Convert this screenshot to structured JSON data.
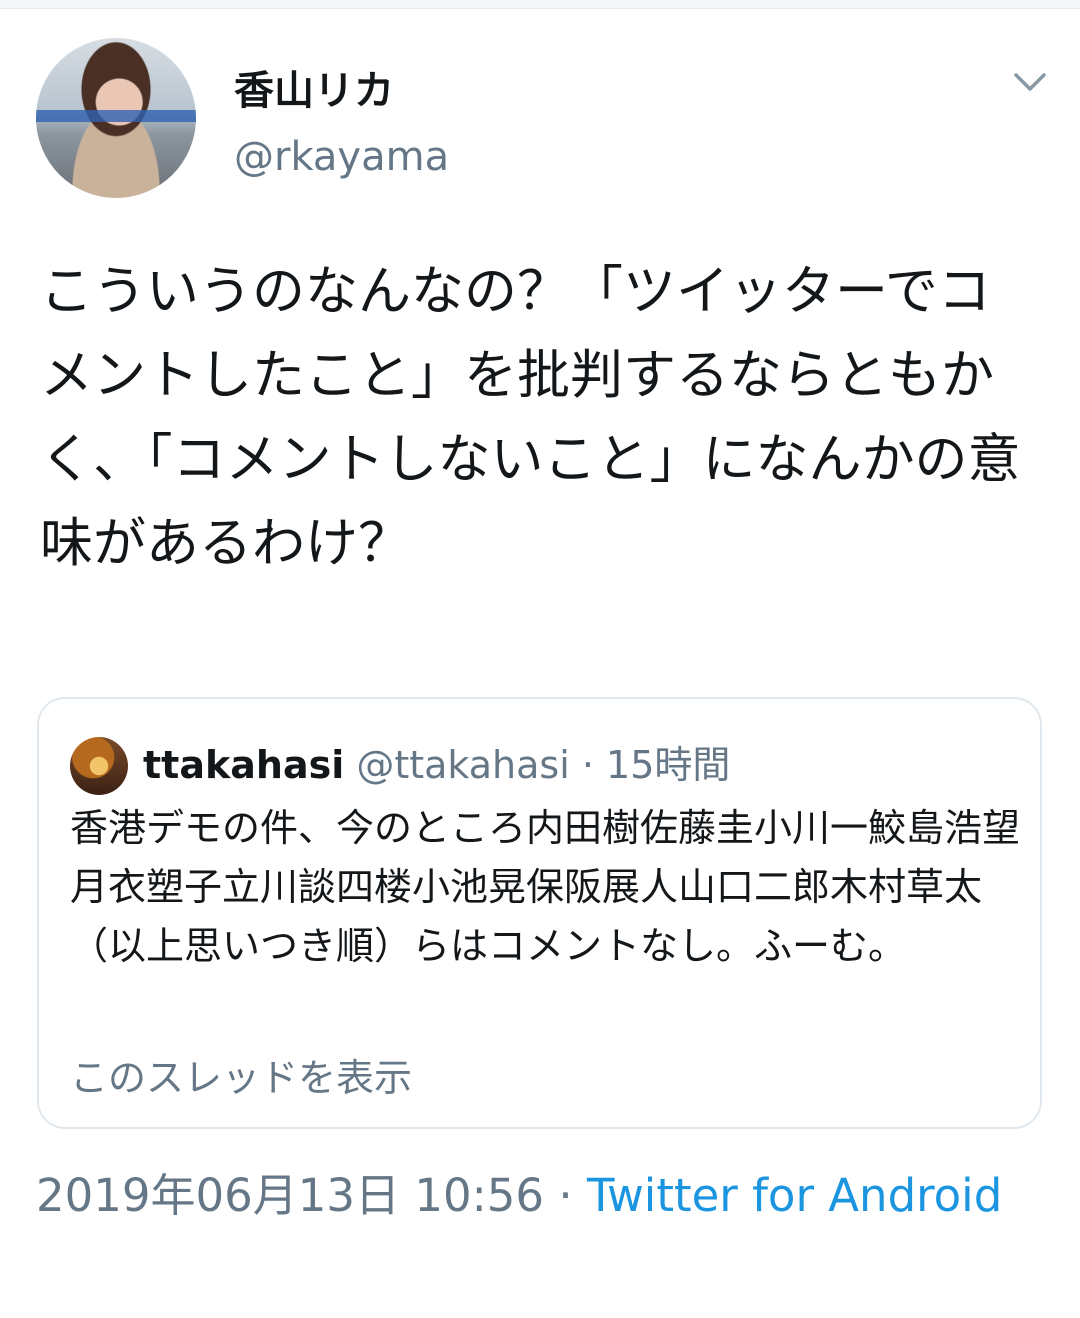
{
  "author": {
    "display_name": "香山リカ",
    "handle": "@rkayama"
  },
  "tweet": {
    "text": "こういうのなんなの？「ツイッターでコメントしたこと」を批判するならともかく、「コメントしないこと」になんかの意味があるわけ？"
  },
  "quote": {
    "name": "ttakahasi",
    "handle": "@ttakahasi",
    "separator": "·",
    "time": "15時間",
    "text": "香港デモの件、今のところ内田樹佐藤圭小川一鮫島浩望月衣塑子立川談四楼小池晃保阪展人山口二郎木村草太（以上思いつき順）らはコメントなし。ふーむ。",
    "show_thread": "このスレッドを表示"
  },
  "footer": {
    "timestamp": "2019年06月13日 10:56",
    "separator": "·",
    "source": "Twitter for Android"
  },
  "icons": {
    "menu": "chevron-down-icon"
  },
  "colors": {
    "primary_text": "#14171a",
    "secondary_text": "#657786",
    "link": "#1b95e0",
    "border": "#e1e8ed"
  }
}
